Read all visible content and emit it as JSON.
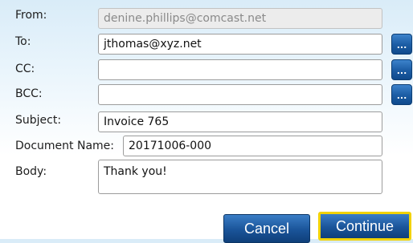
{
  "form": {
    "from": {
      "label": "From:",
      "value": "denine.phillips@comcast.net"
    },
    "to": {
      "label": "To:",
      "value": "jthomas@xyz.net"
    },
    "cc": {
      "label": "CC:",
      "value": ""
    },
    "bcc": {
      "label": "BCC:",
      "value": ""
    },
    "subject": {
      "label": "Subject:",
      "value": "Invoice 765"
    },
    "document_name": {
      "label": "Document Name:",
      "value": "20171006-000"
    },
    "body": {
      "label": "Body:",
      "value": "Thank you!"
    },
    "picker_button_label": "..."
  },
  "actions": {
    "cancel_label": "Cancel",
    "continue_label": "Continue"
  }
}
